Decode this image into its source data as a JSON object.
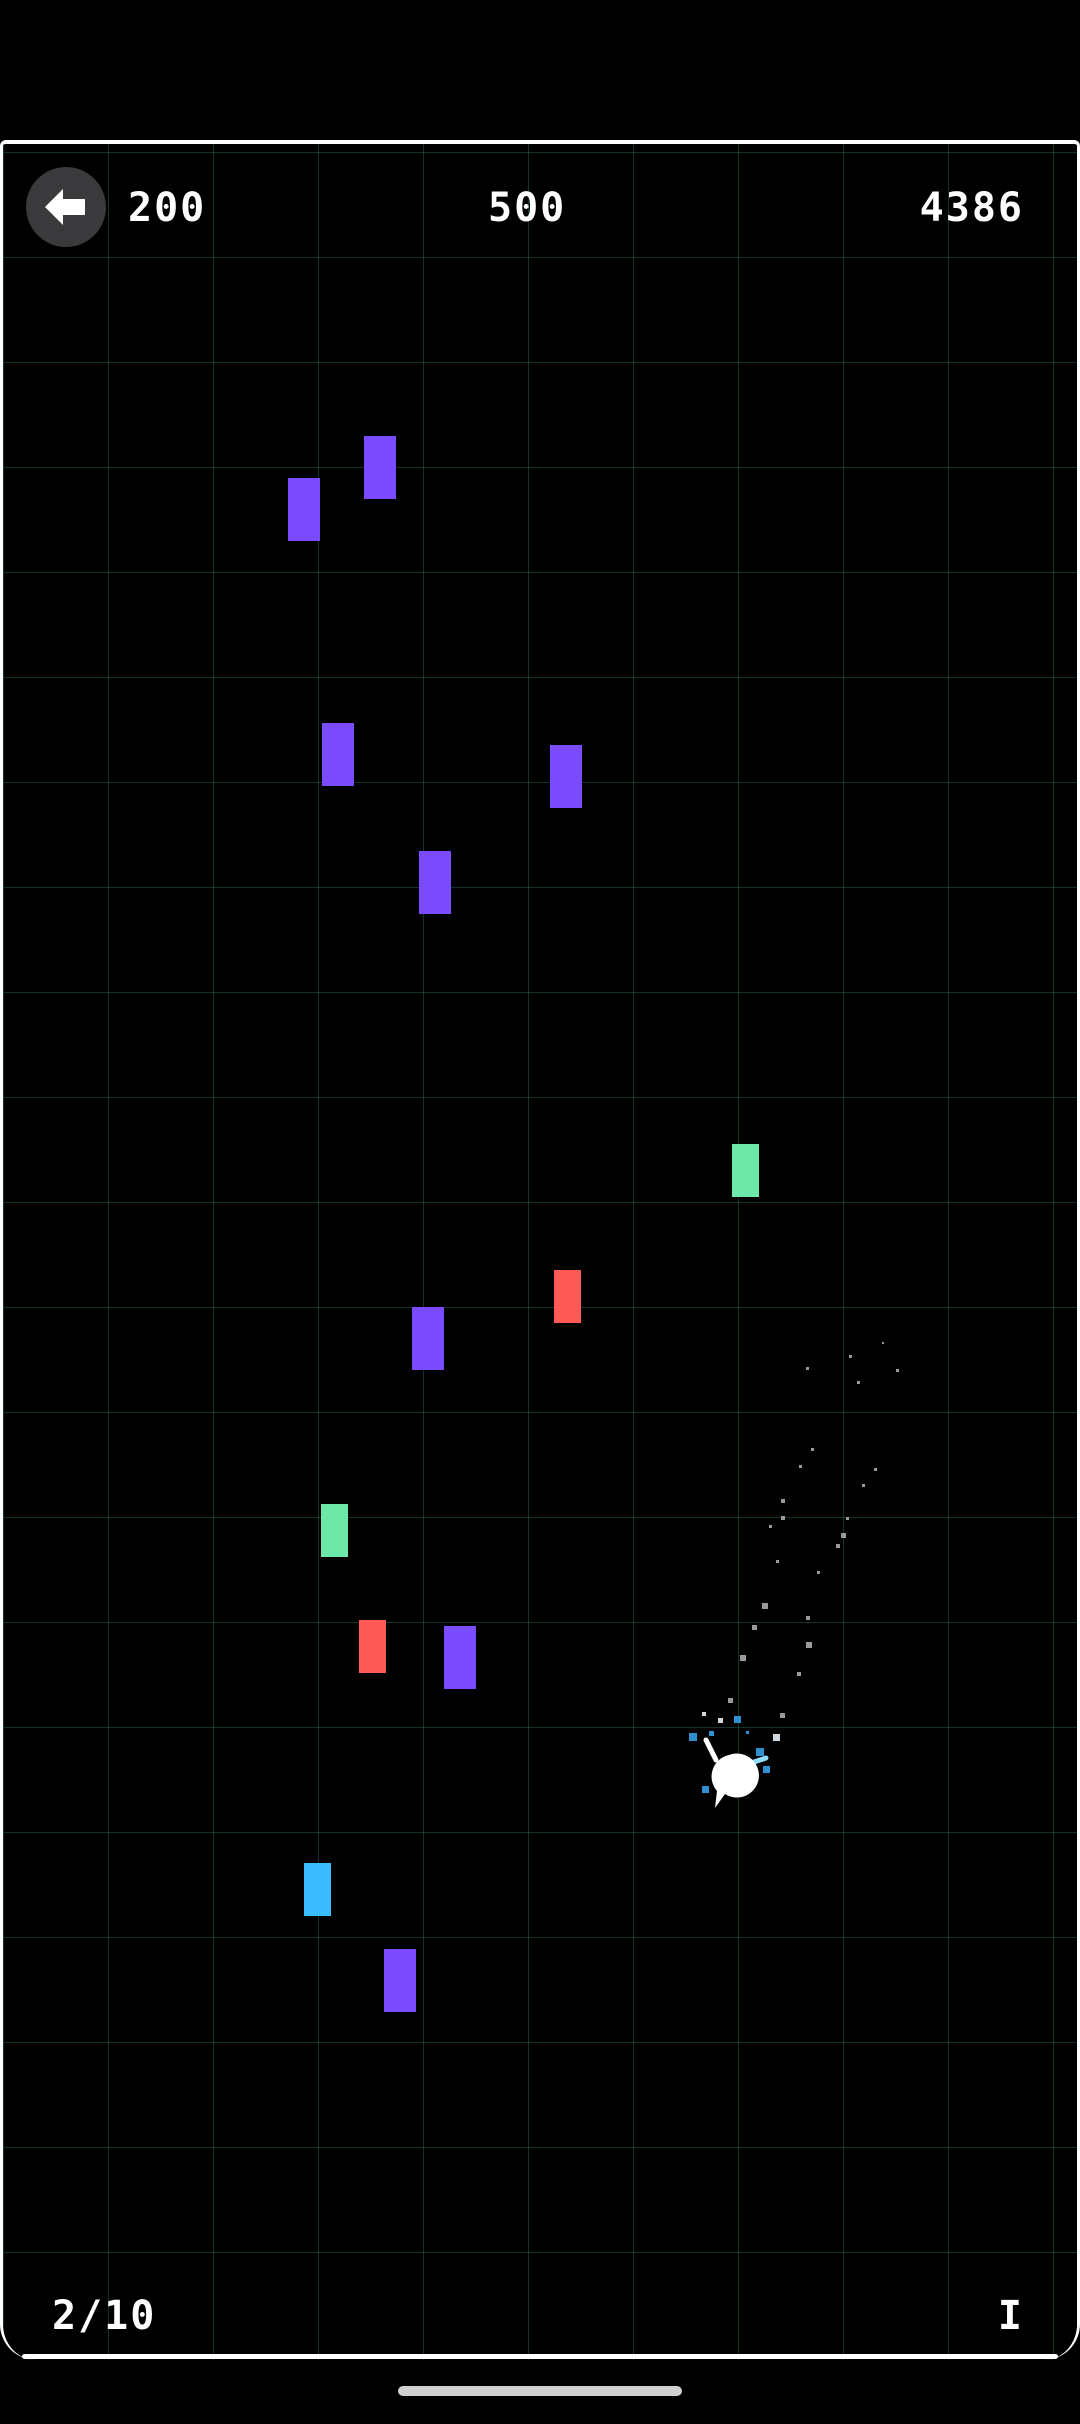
{
  "hud": {
    "score_left": "200",
    "score_center": "500",
    "score_right": "4386",
    "level": "2/10",
    "pause": "I"
  },
  "colors": {
    "background": "#000000",
    "grid_line": "#1f5a52",
    "frame": "#ffffff",
    "purple": "#7b4cff",
    "green": "#6ee8a8",
    "red": "#ff5a55",
    "blue": "#3bbcff",
    "player": "#ffffff",
    "back_button_bg": "#3a3a3c"
  },
  "icons": {
    "back": "arrow-left-icon"
  },
  "blocks": [
    {
      "color": "purple"
    },
    {
      "color": "purple"
    },
    {
      "color": "purple"
    },
    {
      "color": "purple"
    },
    {
      "color": "purple"
    },
    {
      "color": "green"
    },
    {
      "color": "red"
    },
    {
      "color": "purple"
    },
    {
      "color": "green"
    },
    {
      "color": "red"
    },
    {
      "color": "purple"
    },
    {
      "color": "blue"
    },
    {
      "color": "purple"
    }
  ]
}
